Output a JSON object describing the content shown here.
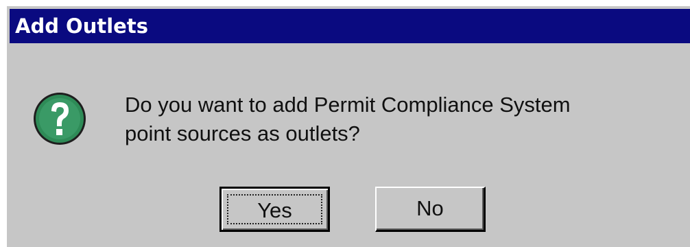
{
  "window": {
    "title": "Add Outlets"
  },
  "dialog": {
    "icon": "question-mark-icon",
    "message_line1": "Do you want to add Permit Compliance System",
    "message_line2": "point sources as outlets?"
  },
  "buttons": {
    "yes_label": "Yes",
    "no_label": "No"
  },
  "colors": {
    "titlebar": "#0a0a80",
    "dialog_bg": "#c6c6c6",
    "icon_green": "#2e8b57"
  }
}
